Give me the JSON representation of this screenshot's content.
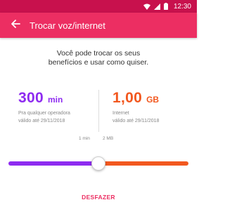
{
  "status_bar": {
    "time": "12:30"
  },
  "app_bar": {
    "title": "Trocar voz/internet"
  },
  "intro": {
    "line1": "Você pode trocar os seus",
    "line2": "benefícios e usar como quiser."
  },
  "voice": {
    "amount": "300",
    "unit": "min",
    "description": "Pra qualquer operadora",
    "validity": "válido até 29/11/2018"
  },
  "data_plan": {
    "amount": "1,00",
    "unit": "GB",
    "description": "Internet",
    "validity": "válido até 29/11/2018"
  },
  "slider": {
    "step_left": "1 min",
    "step_right": "2 MB",
    "position": 0.5
  },
  "actions": {
    "undo_label": "DESFAZER"
  },
  "colors": {
    "status_bar": "#c8114d",
    "app_bar": "#ec2e62",
    "voice": "#8e2bf0",
    "data": "#f2581f"
  }
}
